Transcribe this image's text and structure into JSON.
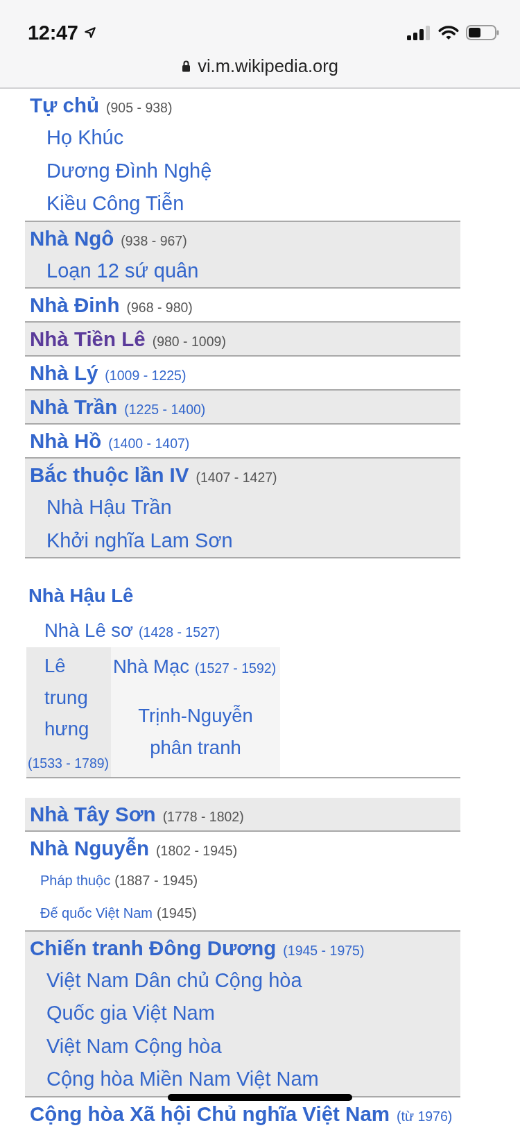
{
  "status_bar": {
    "time": "12:47"
  },
  "address_bar": {
    "url": "vi.m.wikipedia.org"
  },
  "timeline": [
    {
      "kind": "period",
      "title": "Tự chủ",
      "years": "(905 - 938)",
      "shaded": false,
      "visited": false,
      "years_link": false,
      "children": [
        {
          "kind": "major",
          "label": "Họ Khúc"
        },
        {
          "kind": "major",
          "label": "Dương Đình Nghệ"
        },
        {
          "kind": "major",
          "label": "Kiều Công Tiễn"
        }
      ]
    },
    {
      "kind": "period",
      "title": "Nhà Ngô",
      "years": "(938 - 967)",
      "shaded": true,
      "visited": false,
      "years_link": false,
      "children": [
        {
          "kind": "major",
          "label": "Loạn 12 sứ quân"
        }
      ]
    },
    {
      "kind": "period",
      "title": "Nhà Đinh",
      "years": "(968 - 980)",
      "shaded": false,
      "visited": false,
      "years_link": false
    },
    {
      "kind": "period",
      "title": "Nhà Tiền Lê",
      "years": "(980 - 1009)",
      "shaded": true,
      "visited": true,
      "years_link": false
    },
    {
      "kind": "period",
      "title": "Nhà Lý",
      "years": "(1009 - 1225)",
      "shaded": false,
      "visited": false,
      "years_link": true
    },
    {
      "kind": "period",
      "title": "Nhà Trần",
      "years": "(1225 - 1400)",
      "shaded": true,
      "visited": false,
      "years_link": true
    },
    {
      "kind": "period",
      "title": "Nhà Hồ",
      "years": "(1400 - 1407)",
      "shaded": false,
      "visited": false,
      "years_link": true
    },
    {
      "kind": "period",
      "title": "Bắc thuộc lần IV",
      "years": "(1407 - 1427)",
      "shaded": true,
      "visited": false,
      "years_link": false,
      "children": [
        {
          "kind": "major",
          "label": "Nhà Hậu Trần"
        },
        {
          "kind": "major",
          "label": "Khởi nghĩa Lam Sơn"
        }
      ]
    },
    {
      "kind": "split",
      "title": "Nhà Hậu Lê",
      "first": {
        "title": "Nhà Lê sơ",
        "years": "(1428 - 1527)"
      },
      "left": {
        "title": "Lê trung hưng",
        "years": "(1533 - 1789)"
      },
      "right_top": {
        "title": "Nhà Mạc",
        "years": "(1527 - 1592)"
      },
      "right_bottom": {
        "title": "Trịnh-Nguyễn phân tranh"
      }
    },
    {
      "kind": "period",
      "title": "Nhà Tây Sơn",
      "years": "(1778 - 1802)",
      "shaded": true,
      "visited": false,
      "years_link": false
    },
    {
      "kind": "period",
      "title": "Nhà Nguyễn",
      "years": "(1802 - 1945)",
      "shaded": false,
      "visited": false,
      "years_link": false,
      "children": [
        {
          "kind": "minor",
          "label": "Pháp thuộc",
          "years": "(1887 - 1945)"
        },
        {
          "kind": "minor",
          "label": "Đế quốc Việt Nam",
          "years": "(1945)"
        }
      ]
    },
    {
      "kind": "period",
      "title": "Chiến tranh Đông Dương",
      "years": "(1945 - 1975)",
      "shaded": true,
      "visited": false,
      "years_link": true,
      "children": [
        {
          "kind": "major",
          "label": "Việt Nam Dân chủ Cộng hòa"
        },
        {
          "kind": "major",
          "label": "Quốc gia Việt Nam"
        },
        {
          "kind": "major",
          "label": "Việt Nam Cộng hòa"
        },
        {
          "kind": "major",
          "label": "Cộng hòa Miền Nam Việt Nam"
        }
      ]
    },
    {
      "kind": "period",
      "title": "Cộng hòa Xã hội Chủ nghĩa Việt Nam",
      "years": "(từ 1976)",
      "shaded": false,
      "visited": false,
      "years_link": true
    }
  ]
}
